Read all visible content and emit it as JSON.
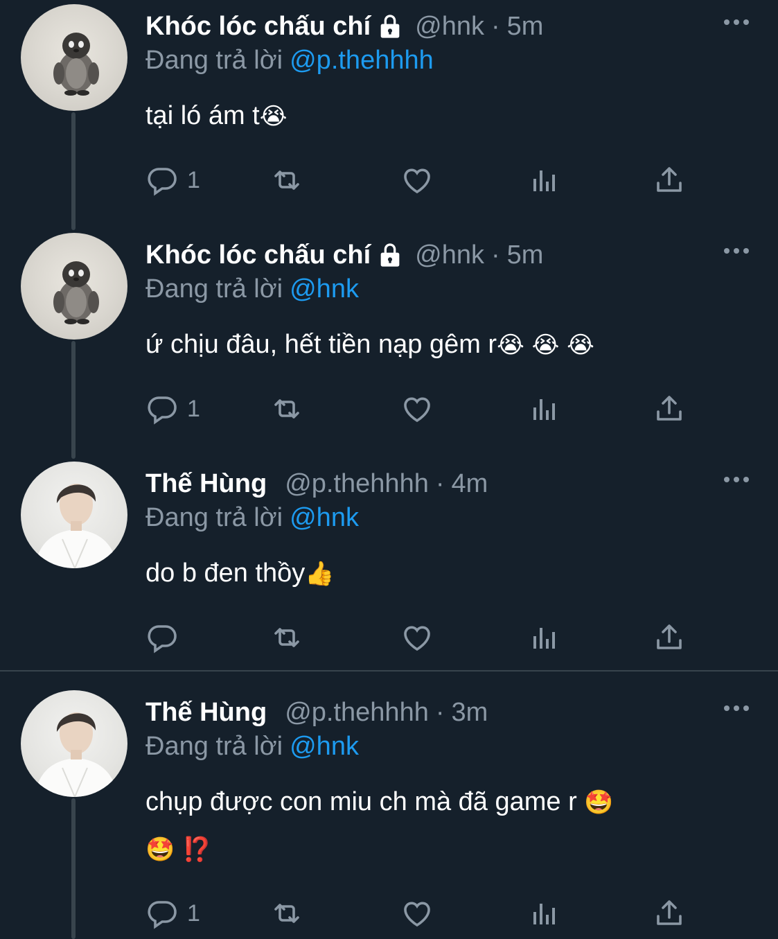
{
  "tweets": [
    {
      "name": "Khóc lóc chấu chí",
      "locked": true,
      "handle": "@hnk",
      "time": "5m",
      "replying_label": "Đang trả lời",
      "replying_to": "@p.thehhhh",
      "text": "tại ló ám t",
      "emojis": "😭",
      "emojis2": "",
      "reply_count": "1",
      "avatar": "penguin-plush-avatar"
    },
    {
      "name": "Khóc lóc chấu chí",
      "locked": true,
      "handle": "@hnk",
      "time": "5m",
      "replying_label": "Đang trả lời",
      "replying_to": "@hnk",
      "text": "ứ chịu đâu, hết tiền nạp gêm r",
      "emojis": "😭 😭 😭",
      "emojis2": "",
      "reply_count": "1",
      "avatar": "penguin-plush-avatar"
    },
    {
      "name": "Thế Hùng",
      "locked": false,
      "handle": "@p.thehhhh",
      "time": "4m",
      "replying_label": "Đang trả lời",
      "replying_to": "@hnk",
      "text": "do b đen thồy",
      "emojis": "👍",
      "emojis2": "",
      "reply_count": "",
      "avatar": "person-avatar"
    },
    {
      "name": "Thế Hùng",
      "locked": false,
      "handle": "@p.thehhhh",
      "time": "3m",
      "replying_label": "Đang trả lời",
      "replying_to": "@hnk",
      "text": "chụp được con miu ch mà đã game r",
      "emojis": "🤩",
      "emojis2": "🤩 ⁉️",
      "reply_count": "1",
      "avatar": "person-avatar"
    }
  ],
  "colors": {
    "background": "#15202b",
    "text": "#ffffff",
    "secondary": "#8b98a5",
    "accent": "#1d9bf0",
    "divider": "#38444d"
  },
  "icons": [
    "lock-icon",
    "more-icon",
    "reply-icon",
    "retweet-icon",
    "like-icon",
    "views-icon",
    "share-icon"
  ]
}
